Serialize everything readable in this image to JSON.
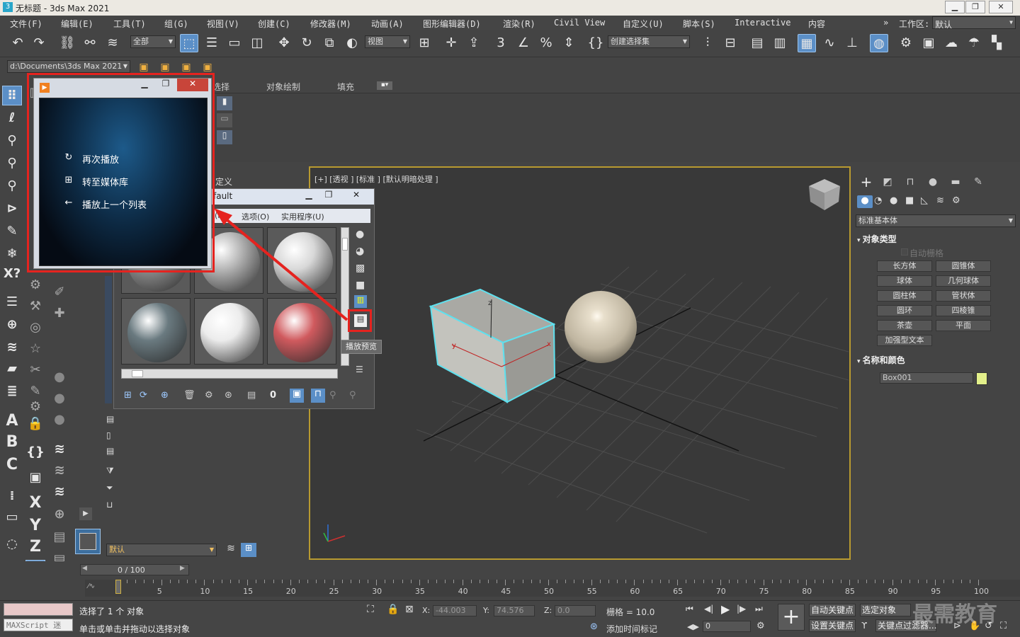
{
  "window": {
    "title": "无标题 - 3ds Max 2021",
    "btn_min": "▁",
    "btn_max": "❐",
    "btn_close": "✕"
  },
  "menu": [
    "文件(F)",
    "编辑(E)",
    "工具(T)",
    "组(G)",
    "视图(V)",
    "创建(C)",
    "修改器(M)",
    "动画(A)",
    "图形编辑器(D)",
    "渲染(R)",
    "Civil View",
    "自定义(U)",
    "脚本(S)",
    "Interactive",
    "内容"
  ],
  "workspace": {
    "label": "工作区:",
    "value": "默认"
  },
  "toolbar": {
    "filter": "全部",
    "ref_coord": "视图",
    "selection_set": "创建选择集"
  },
  "project_path": "d:\\Documents\\3ds Max 2021",
  "ribbon_tabs": {
    "select": "选择",
    "paint": "对象绘制",
    "fill": "填充"
  },
  "scene_explorer": {
    "custom": "定义",
    "layer": "默认"
  },
  "viewport": {
    "label": "[+] [透视 ] [标准 ] [默认明暗处理 ]"
  },
  "command_panel": {
    "category": "标准基本体",
    "object_type_title": "对象类型",
    "auto_grid": "自动栅格",
    "buttons": [
      "长方体",
      "圆锥体",
      "球体",
      "几何球体",
      "圆柱体",
      "管状体",
      "圆环",
      "四棱锥",
      "茶壶",
      "平面"
    ],
    "extended_text": "加强型文本",
    "name_color_title": "名称和颜色",
    "object_name": "Box001",
    "object_color": "#e3f08a"
  },
  "material_editor": {
    "title_frag": "fault",
    "menu": [
      "(N)",
      "选项(O)",
      "实用程序(U)"
    ],
    "tooltip": "播放预览",
    "slot_colors": [
      "#8c8c8c",
      "#b5b5b5",
      "#d8d8d8",
      "#6a7a80",
      "#ececec",
      "#d05a5e"
    ]
  },
  "media_player": {
    "items": [
      {
        "icon": "↻",
        "label": "再次播放"
      },
      {
        "icon": "⊞",
        "label": "转至媒体库"
      },
      {
        "icon": "←",
        "label": "播放上一个列表"
      }
    ]
  },
  "timeline": {
    "frame": "0 / 100",
    "ticks": [
      "5",
      "10",
      "15",
      "20",
      "25",
      "30",
      "35",
      "40",
      "45",
      "50",
      "55",
      "60",
      "65",
      "70",
      "75",
      "80",
      "85",
      "90",
      "95",
      "100"
    ]
  },
  "status": {
    "selected": "选择了 1 个 对象",
    "hint": "单击或单击并拖动以选择对象",
    "maxscript": "MAXScript 迷",
    "x_label": "X:",
    "x": "-44.003",
    "y_label": "Y:",
    "y": "74.576",
    "z_label": "Z:",
    "z": "0.0",
    "grid": "栅格 = 10.0",
    "add_tag": "添加时间标记",
    "auto_key": "自动关键点",
    "set_key": "设置关键点",
    "selected_obj": "选定对象",
    "key_filter": "关键点过滤器...",
    "frame_field": "0"
  },
  "watermark": "最需教育"
}
